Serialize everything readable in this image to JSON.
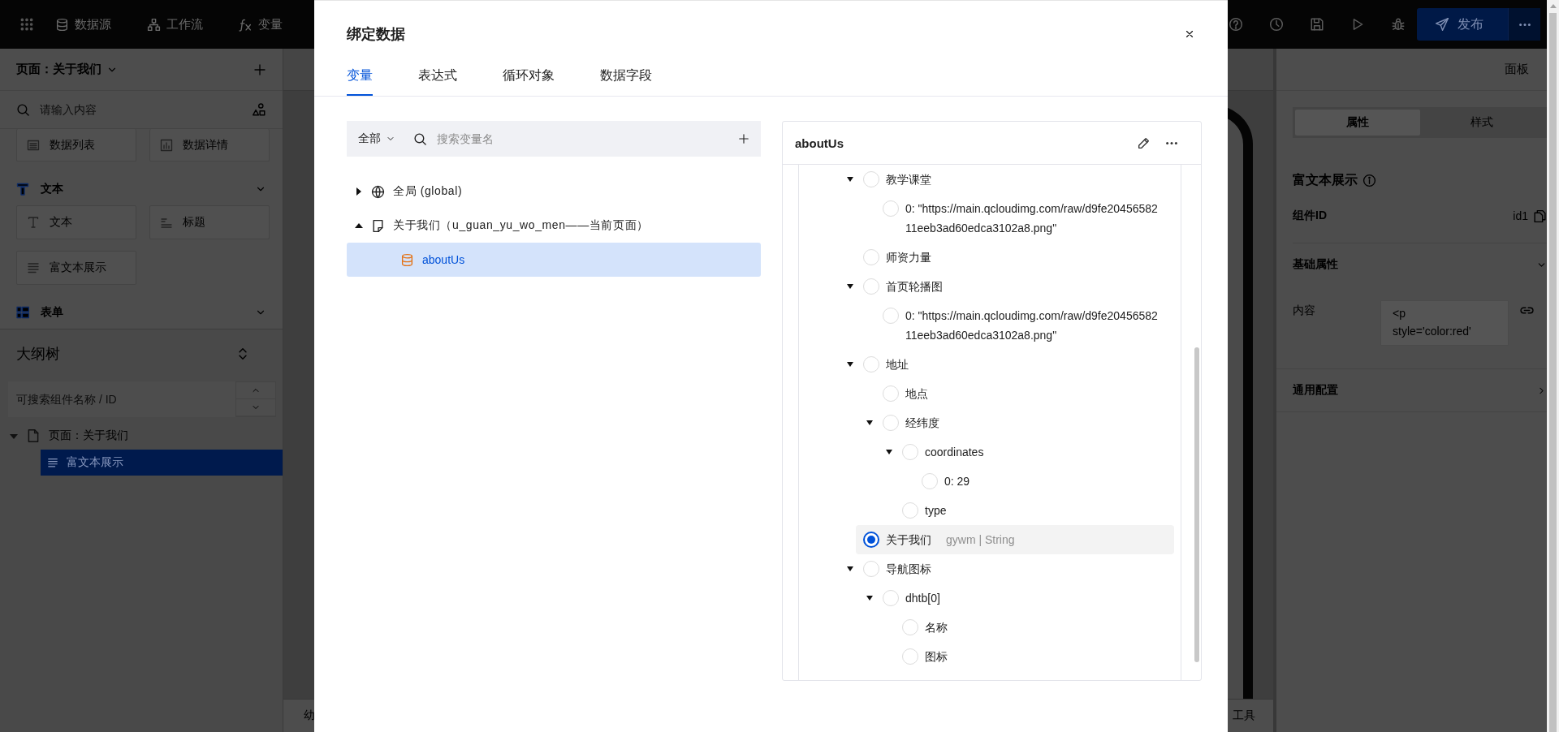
{
  "topbar": {
    "nav": [
      {
        "label": "数据源",
        "kind": "database"
      },
      {
        "label": "工作流",
        "kind": "flow"
      },
      {
        "label": "变量",
        "kind": "fx"
      }
    ],
    "publish": "发布"
  },
  "sidebar": {
    "page_title": "页面：关于我们",
    "search": {
      "placeholder": "请输入内容"
    },
    "groups": [
      {
        "items": [
          {
            "label": "数据列表",
            "kind": "list"
          },
          {
            "label": "数据详情",
            "kind": "chart"
          }
        ]
      },
      {
        "title": "文本",
        "kind": "text",
        "items": [
          {
            "label": "文本",
            "kind": "text"
          },
          {
            "label": "标题",
            "kind": "heading"
          },
          {
            "label": "富文本展示",
            "kind": "paragraph"
          }
        ]
      },
      {
        "title": "表单",
        "kind": "form"
      }
    ]
  },
  "outline": {
    "title": "大纲树",
    "search": {
      "placeholder": "可搜索组件名称 / ID"
    },
    "tree": [
      {
        "label": "页面：关于我们",
        "expanded": true,
        "selected": false,
        "children": [
          {
            "label": "富文本展示",
            "selected": true
          }
        ]
      }
    ]
  },
  "canvas": {
    "footer_left": "幼",
    "footer_right": "工具"
  },
  "properties": {
    "panel_label": "面板",
    "tabs": [
      {
        "label": "属性",
        "selected": true
      },
      {
        "label": "样式",
        "selected": false
      }
    ],
    "title": "富文本展示",
    "id_label": "组件ID",
    "id_value": "id1",
    "sections": [
      {
        "title": "基础属性",
        "expanded": true,
        "field": {
          "label": "内容",
          "value": "<p style='color:red'"
        }
      },
      {
        "title": "通用配置",
        "expanded": false
      }
    ]
  },
  "modal": {
    "title": "绑定数据",
    "tabs": [
      {
        "label": "变量",
        "selected": true
      },
      {
        "label": "表达式",
        "selected": false
      },
      {
        "label": "循环对象",
        "selected": false
      },
      {
        "label": "数据字段",
        "selected": false
      }
    ],
    "filter": {
      "scope": "全部",
      "placeholder": "搜索变量名"
    },
    "variables": [
      {
        "label": "全局 (global)",
        "kind": "global",
        "expanded": false,
        "selected": false
      },
      {
        "label": "关于我们（u_guan_yu_wo_men——当前页面）",
        "kind": "page",
        "expanded": true,
        "selected": false,
        "children": [
          {
            "label": "aboutUs",
            "kind": "data",
            "selected": true
          }
        ]
      }
    ],
    "detail": {
      "title": "aboutUs",
      "fields": [
        {
          "label": "教学课堂",
          "expanded": true,
          "selected": false,
          "children": [
            {
              "label": "0: \"https://main.qcloudimg.com/raw/d9fe2045658211eeb3ad60edca3102a8.png\"",
              "selected": false
            }
          ]
        },
        {
          "label": "师资力量",
          "selected": false
        },
        {
          "label": "首页轮播图",
          "expanded": true,
          "selected": false,
          "children": [
            {
              "label": "0: \"https://main.qcloudimg.com/raw/d9fe2045658211eeb3ad60edca3102a8.png\"",
              "selected": false
            }
          ]
        },
        {
          "label": "地址",
          "expanded": true,
          "selected": false,
          "children": [
            {
              "label": "地点",
              "selected": false
            },
            {
              "label": "经纬度",
              "expanded": true,
              "selected": false,
              "children": [
                {
                  "label": "coordinates",
                  "expanded": true,
                  "selected": false,
                  "children": [
                    {
                      "label": "0: 29",
                      "selected": false
                    }
                  ]
                },
                {
                  "label": "type",
                  "selected": false
                }
              ]
            }
          ]
        },
        {
          "label": "关于我们",
          "hint": "gywm | String",
          "selected": true
        },
        {
          "label": "导航图标",
          "expanded": true,
          "selected": false,
          "children": [
            {
              "label": "dhtb[0]",
              "expanded": true,
              "selected": false,
              "children": [
                {
                  "label": "名称",
                  "selected": false
                },
                {
                  "label": "图标",
                  "selected": false
                }
              ]
            }
          ]
        }
      ]
    }
  }
}
